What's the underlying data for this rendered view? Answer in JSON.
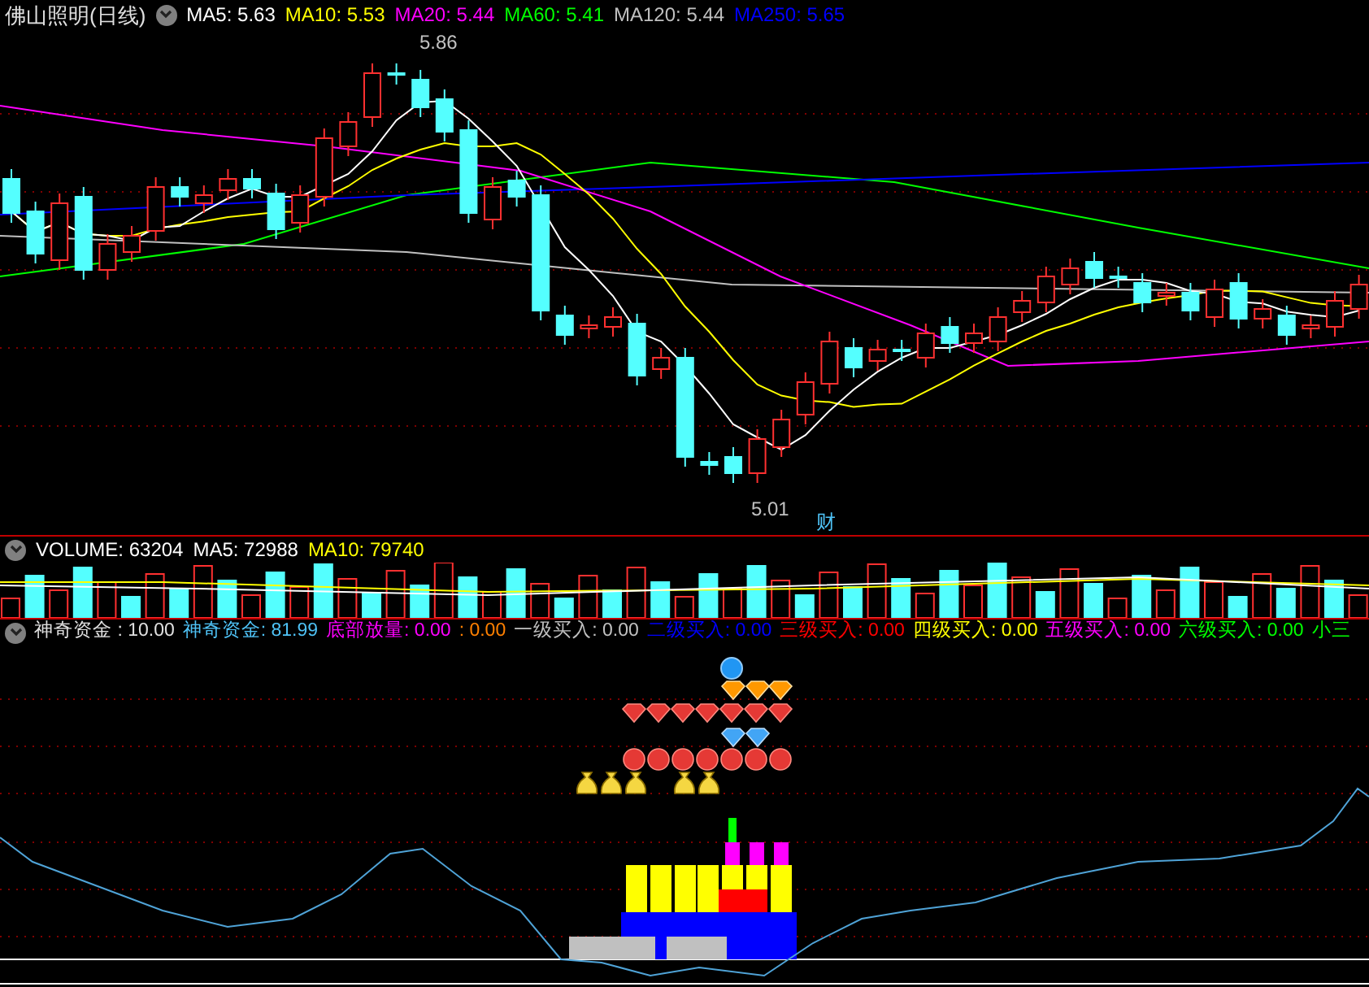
{
  "price_panel": {
    "title": "佛山照明(日线)",
    "indicators": [
      {
        "label": "MA5: 5.63",
        "color": "#ffffff"
      },
      {
        "label": "MA10: 5.53",
        "color": "#ffff00"
      },
      {
        "label": "MA20: 5.44",
        "color": "#ff00ff"
      },
      {
        "label": "MA60: 5.41",
        "color": "#00ff00"
      },
      {
        "label": "MA120: 5.44",
        "color": "#c0c0c0"
      },
      {
        "label": "MA250: 5.65",
        "color": "#0000ff"
      }
    ],
    "high_label": "5.86",
    "low_label": "5.01",
    "badge": "财"
  },
  "volume_panel": {
    "indicators": [
      {
        "label": "VOLUME: 63204",
        "color": "#ffffff"
      },
      {
        "label": "MA5: 72988",
        "color": "#ffffff"
      },
      {
        "label": "MA10: 79740",
        "color": "#ffff00"
      }
    ]
  },
  "indicator_panel": {
    "indicators": [
      {
        "label": "神奇资金 : 10.00",
        "color": "#e0e0e0"
      },
      {
        "label": "神奇资金: 81.99",
        "color": "#4fc3f7"
      },
      {
        "label": "底部放量: 0.00",
        "color": "#ff00ff"
      },
      {
        "label": ": 0.00",
        "color": "#ff8000"
      },
      {
        "label": "一级买入: 0.00",
        "color": "#c0c0c0"
      },
      {
        "label": "二级买入: 0.00",
        "color": "#0000ff"
      },
      {
        "label": "三级买入: 0.00",
        "color": "#ff0000"
      },
      {
        "label": "四级买入: 0.00",
        "color": "#ffff00"
      },
      {
        "label": "五级买入: 0.00",
        "color": "#ff00ff"
      },
      {
        "label": "六级买入: 0.00",
        "color": "#00ff00"
      },
      {
        "label": "小三",
        "color": "#00ff00"
      }
    ]
  }
}
